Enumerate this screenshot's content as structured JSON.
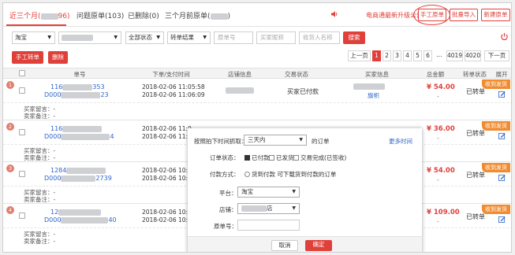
{
  "tabs": [
    {
      "label": "近三个月(",
      "suffix": "96)",
      "active": true
    },
    {
      "label": "问题原单(103)"
    },
    {
      "label": "已删除(0)"
    },
    {
      "label": "三个月前原单("
    }
  ],
  "top_right": {
    "notice": "电商通最新升级公告",
    "manual_order": "手工原单",
    "bulk_import": "批量导入",
    "new_order": "新建原单"
  },
  "filters": {
    "platform": "淘宝",
    "status": "全部状态",
    "convert_result": "转单结果",
    "order_no_placeholder": "原单号",
    "buyer_nick_placeholder": "买家昵称",
    "receiver_placeholder": "收货人名称",
    "search": "搜索"
  },
  "actions": {
    "manual_convert": "手工转单",
    "delete": "删除"
  },
  "pager": {
    "prev": "上一页",
    "pages": [
      "1",
      "2",
      "3",
      "4",
      "5",
      "6",
      "...",
      "4019",
      "4020"
    ],
    "current": "1",
    "next": "下一页"
  },
  "table_headers": [
    "单号",
    "下单/支付时间",
    "店铺信息",
    "交易状态",
    "买家信息",
    "总金额",
    "转单状态",
    "展开"
  ],
  "orders": [
    {
      "badge": "1",
      "num1": "116",
      "num1b": "353",
      "num2": "D000",
      "num2b": "23",
      "time1": "2018-02-06 11:05:58",
      "time2": "2018-02-06 11:06:09",
      "state": "买家已付款",
      "buyer_link": "旗帜",
      "price": "¥ 54.00",
      "dash": "-",
      "convert": "已转单",
      "corner": "收到发货",
      "note1": "买家留言：-",
      "note2": "卖家备注：-"
    },
    {
      "badge": "2",
      "num1": "116",
      "num1b": "",
      "num2": "D000",
      "num2b": "4",
      "time1": "2018-02-06 11:0",
      "time2": "2018-02-06 11:0",
      "state": "",
      "buyer_link": "",
      "price": "¥ 36.00",
      "dash": "-",
      "convert": "已转单",
      "corner": "收到发货",
      "note1": "买家留言：-",
      "note2": "卖家备注：-"
    },
    {
      "badge": "3",
      "num1": "1284",
      "num1b": "",
      "num2": "D000",
      "num2b": "2739",
      "time1": "2018-02-06 10:5",
      "time2": "2018-02-06 10:5",
      "state": "",
      "buyer_link": "",
      "price": "¥ 54.00",
      "dash": "-",
      "convert": "已转单",
      "corner": "收到发货",
      "note1": "买家留言：-",
      "note2": "卖家备注：-"
    },
    {
      "badge": "4",
      "num1": "12",
      "num1b": "",
      "num2": "D000",
      "num2b": "40",
      "time1": "2018-02-06 10:5",
      "time2": "2018-02-06 10:5",
      "state": "",
      "buyer_link": "",
      "price": "¥ 109.00",
      "dash": "-",
      "convert": "已转单",
      "corner": "收到发货",
      "note1": "买家留言：-",
      "note2": "卖家备注：-"
    }
  ],
  "modal": {
    "grab_label": "按照拍下时间抓取：",
    "grab_value": "三天内",
    "grab_suffix": "的订单",
    "more_time": "更多时间",
    "status_label": "订单状态：",
    "status_opt1": "已付款",
    "status_opt2": "已发货",
    "status_opt3": "交易完成(已签收)",
    "pay_label": "付款方式：",
    "pay_opt": "货到付款 可下载货到付款的订单",
    "platform_label": "平台：",
    "platform_value": "淘宝",
    "shop_label": "店铺：",
    "shop_suffix": "店",
    "order_no_label": "原单号：",
    "cancel": "取消",
    "confirm": "确定"
  },
  "colors": {
    "accent": "#e0403a",
    "link": "#2f66c8",
    "badge": "#f08c2f"
  }
}
